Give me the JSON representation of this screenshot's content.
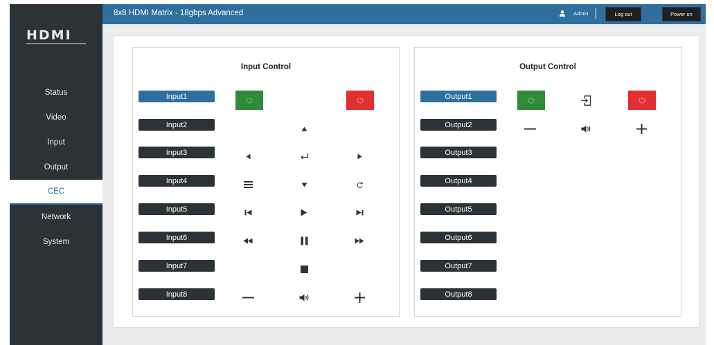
{
  "header": {
    "title": "8x8 HDMI Matrix - 18gbps Advanced",
    "user": "Admin",
    "logout_label": "Log out",
    "poweron_label": "Power on"
  },
  "brand": {
    "logo_text": "HDMI"
  },
  "sidebar": {
    "items": [
      {
        "label": "Status",
        "active": false
      },
      {
        "label": "Video",
        "active": false
      },
      {
        "label": "Input",
        "active": false
      },
      {
        "label": "Output",
        "active": false
      },
      {
        "label": "CEC",
        "active": true
      },
      {
        "label": "Network",
        "active": false
      },
      {
        "label": "System",
        "active": false
      }
    ]
  },
  "input_control": {
    "title": "Input Control",
    "inputs": [
      "Input1",
      "Input2",
      "Input3",
      "Input4",
      "Input5",
      "Input6",
      "Input7",
      "Input8"
    ],
    "selected": "Input1"
  },
  "output_control": {
    "title": "Output Control",
    "outputs": [
      "Output1",
      "Output2",
      "Output3",
      "Output4",
      "Output5",
      "Output6",
      "Output7",
      "Output8"
    ],
    "selected": "Output1"
  },
  "icons": {
    "power_on": "power-icon",
    "power_off": "power-icon",
    "up": "arrow-up-icon",
    "down": "arrow-down-icon",
    "left": "arrow-left-icon",
    "right": "arrow-right-icon",
    "enter": "enter-icon",
    "menu": "menu-icon",
    "back": "return-icon",
    "prev": "skip-previous-icon",
    "play": "play-icon",
    "next": "skip-next-icon",
    "rewind": "rewind-icon",
    "pause": "pause-icon",
    "forward": "fast-forward-icon",
    "stop": "stop-icon",
    "vol_down": "minus-icon",
    "mute": "volume-icon",
    "vol_up": "plus-icon",
    "source": "input-source-icon"
  },
  "colors": {
    "accent": "#2e6f9e",
    "sidebar": "#2c3336",
    "power_on": "#2f8a3a",
    "power_off": "#e13032"
  }
}
